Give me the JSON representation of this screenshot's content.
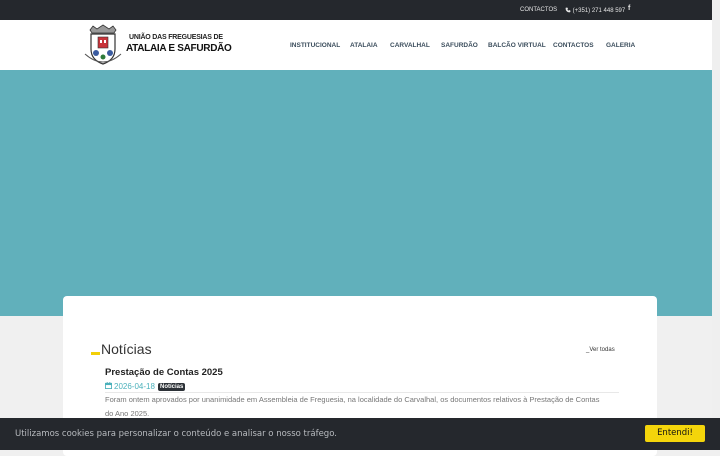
{
  "topbar": {
    "contacts_label": "CONTACTOS",
    "phone": "(+351) 271 448 597",
    "phone_icon": "phone-icon",
    "facebook_icon": "facebook-icon",
    "facebook_glyph": "f"
  },
  "logo": {
    "line1": "UNIÃO DAS FREGUESIAS DE",
    "line2": "ATALAIA E SAFURDÃO"
  },
  "nav": {
    "items": [
      "INSTITUCIONAL",
      "ATALAIA",
      "CARVALHAL",
      "SAFURDÃO",
      "BALCÃO VIRTUAL",
      "CONTACTOS",
      "GALERIA"
    ]
  },
  "news": {
    "title": "Notícias",
    "view_all": "_Ver todas",
    "items": [
      {
        "title": "Prestação de Contas 2025",
        "date": "2026-04-18",
        "category": "Notícias",
        "summary": "Foram ontem aprovados por unanimidade em Assembleia de Freguesia, na localidade do Carvalhal, os documentos relativos à Prestação de Contas do Ano 2025."
      }
    ]
  },
  "cookie": {
    "message": "Utilizamos cookies para personalizar o conteúdo e analisar o nosso tráfego.",
    "button": "Entendi!"
  },
  "colors": {
    "topbar": "#25282d",
    "hero": "#61b0bb",
    "accent_yellow": "#f4d50b",
    "date_teal": "#4bb1bb"
  }
}
